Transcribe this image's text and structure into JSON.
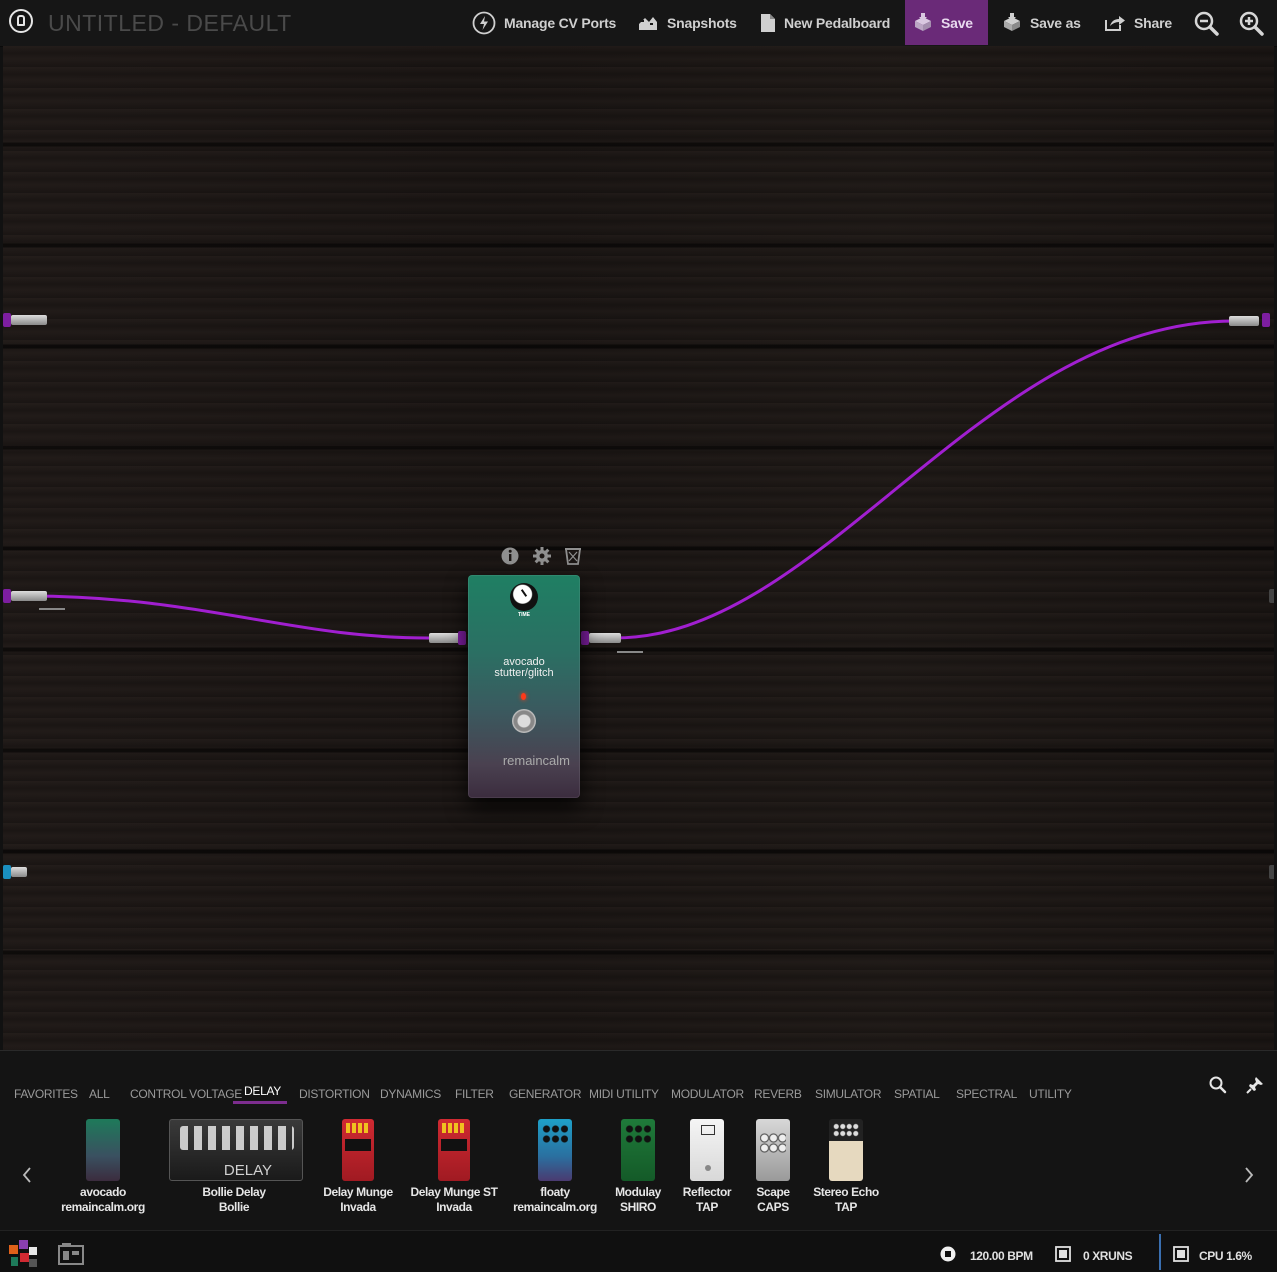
{
  "topbar": {
    "title": "UNTITLED - DEFAULT",
    "buttons": {
      "manage_cv": "Manage CV Ports",
      "snapshots": "Snapshots",
      "new_pedalboard": "New Pedalboard",
      "save": "Save",
      "save_as": "Save as",
      "share": "Share"
    }
  },
  "pedal": {
    "knob_label": "TIME",
    "name_line1": "avocado",
    "name_line2": "stutter/glitch",
    "brand": "remaincalm"
  },
  "pluginbar": {
    "categories": [
      "FAVORITES",
      "ALL",
      "CONTROL VOLTAGE",
      "DELAY",
      "DISTORTION",
      "DYNAMICS",
      "FILTER",
      "GENERATOR",
      "MIDI UTILITY",
      "MODULATOR",
      "REVERB",
      "SIMULATOR",
      "SPATIAL",
      "SPECTRAL",
      "UTILITY"
    ],
    "active_category": "DELAY",
    "plugins": [
      {
        "name": "avocado",
        "brand": "remaincalm.org",
        "color": "#1e7a5a"
      },
      {
        "name": "Bollie Delay",
        "brand": "Bollie",
        "color": "#2a2a2a",
        "thumb_text": "DELAY"
      },
      {
        "name": "Delay Munge",
        "brand": "Invada",
        "color": "#c8252d"
      },
      {
        "name": "Delay Munge ST",
        "brand": "Invada",
        "color": "#c8252d"
      },
      {
        "name": "floaty",
        "brand": "remaincalm.org",
        "color": "#1ea0c8"
      },
      {
        "name": "Modulay",
        "brand": "SHIRO",
        "color": "#1f7a3a"
      },
      {
        "name": "Reflector",
        "brand": "TAP",
        "color": "#f0f0f0"
      },
      {
        "name": "Scape",
        "brand": "CAPS",
        "color": "#c8c8c8"
      },
      {
        "name": "Stereo Echo",
        "brand": "TAP",
        "color": "#e6d9bf"
      }
    ]
  },
  "status": {
    "bpm": "120.00 BPM",
    "xruns": "0 XRUNS",
    "cpu": "CPU 1.6%"
  },
  "colors": {
    "accent": "#6a2a78",
    "cable": "#9a1fc4",
    "board": "#1b1614"
  }
}
